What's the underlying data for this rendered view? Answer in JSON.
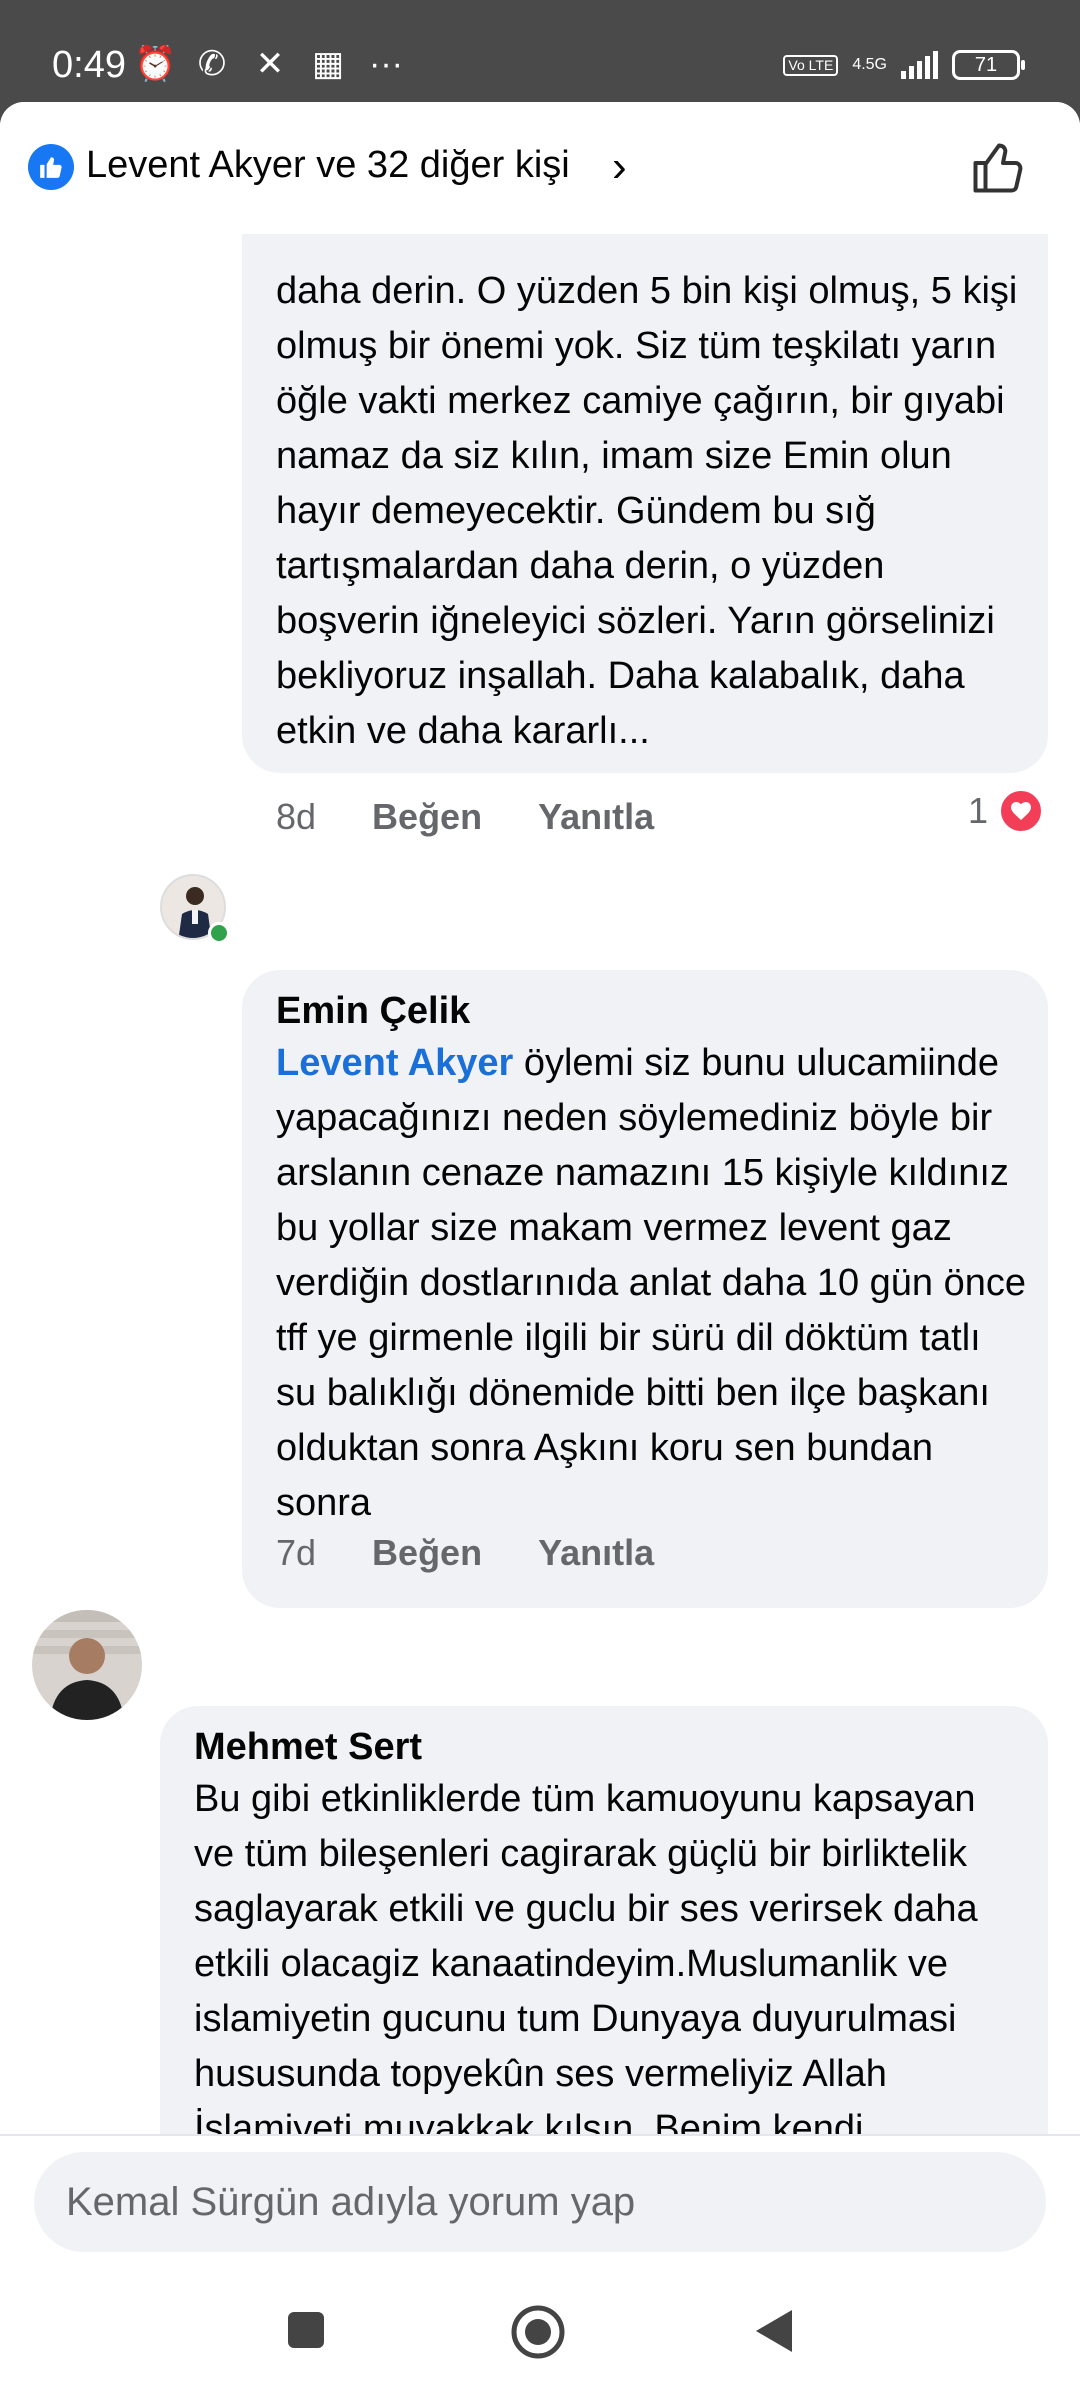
{
  "status_bar": {
    "time": "0:49",
    "network": "4.5G",
    "volte": "Vo LTE",
    "battery": "71",
    "more": "···"
  },
  "header": {
    "title": "Levent Akyer ve 32 diğer kişi",
    "chevron": "›"
  },
  "comments": [
    {
      "text": "daha derin. O yüzden 5 bin kişi olmuş, 5 kişi olmuş bir önemi yok. Siz tüm teşkilatı yarın öğle vakti merkez camiye çağırın, bir gıyabi namaz da siz kılın, imam size Emin olun hayır demeyecektir. Gündem bu sığ tartışmalardan daha derin, o yüzden boşverin iğneleyici sözleri. Yarın görselinizi bekliyoruz inşallah. Daha kalabalık, daha etkin ve daha kararlı...",
      "time": "8d",
      "like_label": "Beğen",
      "reply_label": "Yanıtla",
      "reaction_count": "1"
    },
    {
      "author": "Emin Çelik",
      "mention": "Levent Akyer",
      "text": " öylemi siz bunu ulucamiinde yapacağınızı neden söylemediniz böyle bir arslanın cenaze namazını 15 kişiyle kıldınız bu yollar size makam vermez levent gaz verdiğin dostlarınıda anlat daha 10 gün önce tff ye girmenle ilgili bir sürü dil döktüm tatlı su balıklığı dönemide bitti ben ilçe başkanı olduktan sonra Aşkını koru sen bundan sonra",
      "time": "7d",
      "like_label": "Beğen",
      "reply_label": "Yanıtla"
    },
    {
      "author": "Mehmet Sert",
      "text": "Bu gibi etkinliklerde tüm kamuoyunu kapsayan ve tüm bileşenleri cagirarak güçlü bir birliktelik saglayarak etkili ve guclu bir ses verirsek daha etkili olacagiz kanaatindeyim.Muslumanlik ve islamiyetin gucunu tum Dunyaya duyurulmasi hususunda topyekûn ses vermeliyiz Allah İslamiyeti muvakkak kılsın. Benim kendi görüşüm budur inşallah"
    }
  ],
  "composer": {
    "placeholder": "Kemal Sürgün adıyla yorum yap"
  },
  "colors": {
    "accent": "#1877f2",
    "mention": "#1a6fd8",
    "bubble": "#f0f2f5",
    "heart": "#f33e58",
    "online": "#31a24c"
  }
}
